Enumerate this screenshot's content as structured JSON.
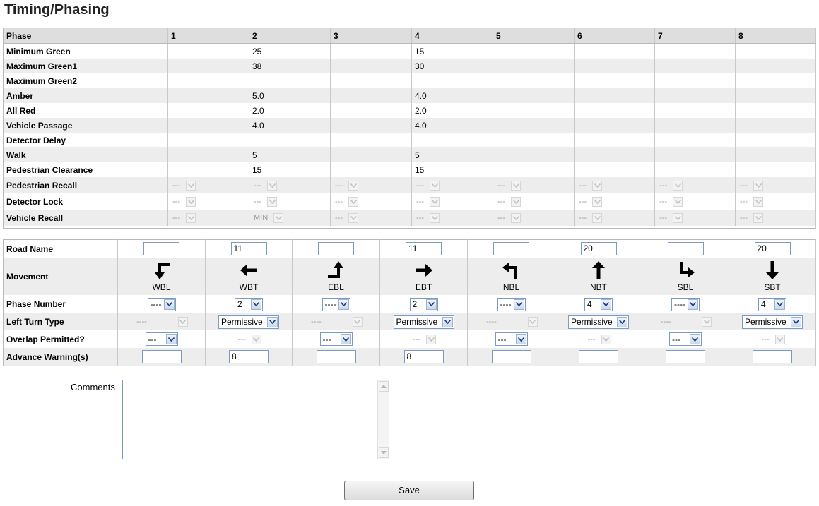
{
  "title": "Timing/Phasing",
  "timing": {
    "header": [
      "Phase",
      "1",
      "2",
      "3",
      "4",
      "5",
      "6",
      "7",
      "8"
    ],
    "rows": [
      {
        "label": "Minimum Green",
        "values": [
          "",
          "25",
          "",
          "15",
          "",
          "",
          "",
          ""
        ]
      },
      {
        "label": "Maximum Green1",
        "values": [
          "",
          "38",
          "",
          "30",
          "",
          "",
          "",
          ""
        ]
      },
      {
        "label": "Maximum Green2",
        "values": [
          "",
          "",
          "",
          "",
          "",
          "",
          "",
          ""
        ]
      },
      {
        "label": "Amber",
        "values": [
          "",
          "5.0",
          "",
          "4.0",
          "",
          "",
          "",
          ""
        ]
      },
      {
        "label": "All Red",
        "values": [
          "",
          "2.0",
          "",
          "2.0",
          "",
          "",
          "",
          ""
        ]
      },
      {
        "label": "Vehicle Passage",
        "values": [
          "",
          "4.0",
          "",
          "4.0",
          "",
          "",
          "",
          ""
        ]
      },
      {
        "label": "Detector Delay",
        "values": [
          "",
          "",
          "",
          "",
          "",
          "",
          "",
          ""
        ]
      },
      {
        "label": "Walk",
        "values": [
          "",
          "5",
          "",
          "5",
          "",
          "",
          "",
          ""
        ]
      },
      {
        "label": "Pedestrian Clearance",
        "values": [
          "",
          "15",
          "",
          "15",
          "",
          "",
          "",
          ""
        ]
      }
    ],
    "select_rows": [
      {
        "label": "Pedestrian Recall",
        "values": [
          "---",
          "---",
          "---",
          "---",
          "---",
          "---",
          "---",
          "---"
        ]
      },
      {
        "label": "Detector Lock",
        "values": [
          "---",
          "---",
          "---",
          "---",
          "---",
          "---",
          "---",
          "---"
        ]
      },
      {
        "label": "Vehicle Recall",
        "values": [
          "---",
          "MIN",
          "---",
          "---",
          "---",
          "---",
          "---",
          "---"
        ]
      }
    ]
  },
  "movement_table": {
    "row_labels": {
      "road_name": "Road Name",
      "movement": "Movement",
      "phase_number": "Phase Number",
      "left_turn_type": "Left Turn Type",
      "overlap_permitted": "Overlap Permitted?",
      "advance_warning": "Advance Warning(s)"
    },
    "columns": [
      {
        "road_name": "",
        "movement": "WBL",
        "icon": "turn-left-from-east-icon",
        "phase_number": "----",
        "left_turn_type": "----",
        "left_turn_enabled": false,
        "overlap": "---",
        "overlap_enabled": true,
        "advance_warning": ""
      },
      {
        "road_name": "11",
        "movement": "WBT",
        "icon": "arrow-left-icon",
        "phase_number": "2",
        "left_turn_type": "Permissive",
        "left_turn_enabled": true,
        "overlap": "---",
        "overlap_enabled": false,
        "advance_warning": "8"
      },
      {
        "road_name": "",
        "movement": "EBL",
        "icon": "turn-left-from-west-icon",
        "phase_number": "----",
        "left_turn_type": "----",
        "left_turn_enabled": false,
        "overlap": "---",
        "overlap_enabled": true,
        "advance_warning": ""
      },
      {
        "road_name": "11",
        "movement": "EBT",
        "icon": "arrow-right-icon",
        "phase_number": "2",
        "left_turn_type": "Permissive",
        "left_turn_enabled": true,
        "overlap": "---",
        "overlap_enabled": false,
        "advance_warning": "8"
      },
      {
        "road_name": "",
        "movement": "NBL",
        "icon": "turn-left-from-south-icon",
        "phase_number": "----",
        "left_turn_type": "----",
        "left_turn_enabled": false,
        "overlap": "---",
        "overlap_enabled": true,
        "advance_warning": ""
      },
      {
        "road_name": "20",
        "movement": "NBT",
        "icon": "arrow-up-icon",
        "phase_number": "4",
        "left_turn_type": "Permissive",
        "left_turn_enabled": true,
        "overlap": "---",
        "overlap_enabled": false,
        "advance_warning": ""
      },
      {
        "road_name": "",
        "movement": "SBL",
        "icon": "turn-left-from-north-icon",
        "phase_number": "----",
        "left_turn_type": "----",
        "left_turn_enabled": false,
        "overlap": "---",
        "overlap_enabled": true,
        "advance_warning": ""
      },
      {
        "road_name": "20",
        "movement": "SBT",
        "icon": "arrow-down-icon",
        "phase_number": "4",
        "left_turn_type": "Permissive",
        "left_turn_enabled": true,
        "overlap": "---",
        "overlap_enabled": false,
        "advance_warning": ""
      }
    ]
  },
  "comments": {
    "label": "Comments",
    "value": ""
  },
  "save_label": "Save"
}
